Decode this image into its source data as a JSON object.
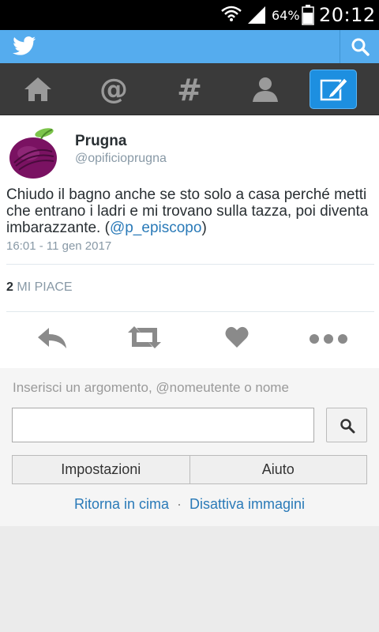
{
  "status_bar": {
    "battery_percent": "64%",
    "time": "20:12",
    "icons": [
      "wifi-icon",
      "signal-icon",
      "battery-icon"
    ]
  },
  "header": {
    "logo_icon": "twitter-bird-icon",
    "search_icon": "search-icon",
    "accent_color": "#55acee"
  },
  "nav": {
    "items": [
      {
        "icon": "home-icon"
      },
      {
        "icon": "mentions-icon"
      },
      {
        "icon": "hashtag-icon"
      },
      {
        "icon": "profile-icon"
      },
      {
        "icon": "compose-icon"
      }
    ]
  },
  "tweet": {
    "display_name": "Prugna",
    "handle": "@opificioprugna",
    "text": "Chiudo il bagno anche se sto solo a casa perché metti che entrano i ladri e mi trovano sulla tazza, poi diventa imbarazzante. (",
    "mention": "@p_episcopo",
    "text_end": ")",
    "timestamp": "16:01 - 11 gen 2017",
    "likes_count": "2",
    "likes_label": "MI PIACE",
    "actions": [
      "reply-icon",
      "retweet-icon",
      "like-icon",
      "more-icon"
    ]
  },
  "footer": {
    "search_placeholder": "Inserisci un argomento, @nomeutente o nome",
    "search_value": "",
    "settings_label": "Impostazioni",
    "help_label": "Aiuto",
    "back_to_top": "Ritorna in cima",
    "separator": "·",
    "disable_images": "Disattiva immagini"
  }
}
